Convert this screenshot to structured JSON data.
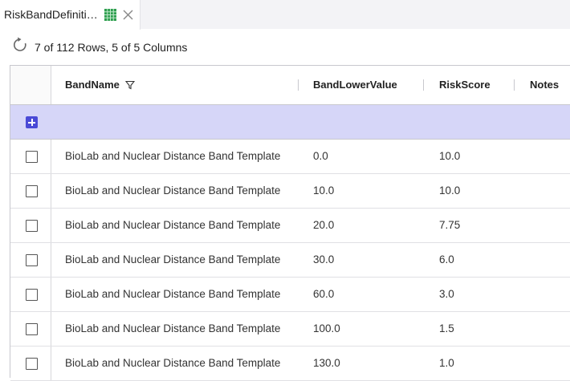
{
  "tab": {
    "title": "RiskBandDefiniti…",
    "icon": "grid-icon",
    "close_icon": "close-icon"
  },
  "status": {
    "refresh_icon": "refresh-icon",
    "row_count": "7 of 112 Rows, 5 of 5 Columns"
  },
  "table": {
    "columns": [
      "BandName",
      "BandLowerValue",
      "RiskScore",
      "Notes"
    ],
    "new_row_icon": "add-icon",
    "rows": [
      {
        "band_name": "BioLab and Nuclear Distance Band Template",
        "band_lower_value": "0.0",
        "risk_score": "10.0",
        "notes": ""
      },
      {
        "band_name": "BioLab and Nuclear Distance Band Template",
        "band_lower_value": "10.0",
        "risk_score": "10.0",
        "notes": ""
      },
      {
        "band_name": "BioLab and Nuclear Distance Band Template",
        "band_lower_value": "20.0",
        "risk_score": "7.75",
        "notes": ""
      },
      {
        "band_name": "BioLab and Nuclear Distance Band Template",
        "band_lower_value": "30.0",
        "risk_score": "6.0",
        "notes": ""
      },
      {
        "band_name": "BioLab and Nuclear Distance Band Template",
        "band_lower_value": "60.0",
        "risk_score": "3.0",
        "notes": ""
      },
      {
        "band_name": "BioLab and Nuclear Distance Band Template",
        "band_lower_value": "100.0",
        "risk_score": "1.5",
        "notes": ""
      },
      {
        "band_name": "BioLab and Nuclear Distance Band Template",
        "band_lower_value": "130.0",
        "risk_score": "1.0",
        "notes": ""
      }
    ]
  },
  "colors": {
    "accent": "#4a4ad6",
    "new_row_background": "#d6d6f8",
    "grid_icon_green": "#2e9e4f"
  }
}
